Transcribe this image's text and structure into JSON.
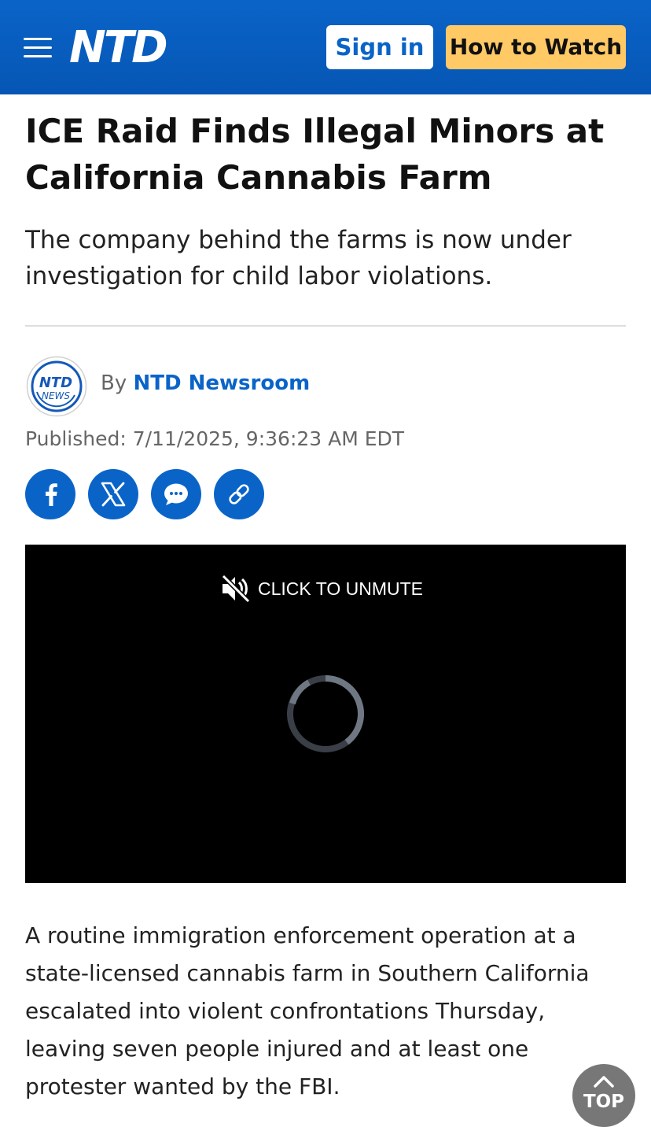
{
  "header": {
    "logo_text": "NTD",
    "signin_label": "Sign in",
    "howto_label": "How to Watch"
  },
  "article": {
    "title": "ICE Raid Finds Illegal Minors at California Cannabis Farm",
    "subtitle": "The company behind the farms is now under investigation for child labor violations.",
    "author_avatar": {
      "logo_top": "NTD",
      "logo_bottom": "NEWS"
    },
    "byline_prefix": "By",
    "author": "NTD Newsroom",
    "published": "Published: 7/11/2025, 9:36:23 AM EDT",
    "body": "A routine immigration enforcement operation at a state-licensed cannabis farm in Southern California escalated into violent confrontations Thursday, leaving seven people injured and at least one protester wanted by the FBI."
  },
  "share": {
    "items": [
      {
        "name": "facebook",
        "icon": "facebook-icon"
      },
      {
        "name": "x",
        "icon": "x-icon"
      },
      {
        "name": "message",
        "icon": "chat-bubble-icon"
      },
      {
        "name": "copy-link",
        "icon": "link-icon"
      }
    ]
  },
  "video": {
    "unmute_label": "CLICK TO UNMUTE",
    "state": "loading"
  },
  "scroll_top": {
    "label": "TOP"
  },
  "colors": {
    "brand_blue": "#0a64c8",
    "accent_yellow": "#ffc966",
    "top_button": "#777777"
  }
}
